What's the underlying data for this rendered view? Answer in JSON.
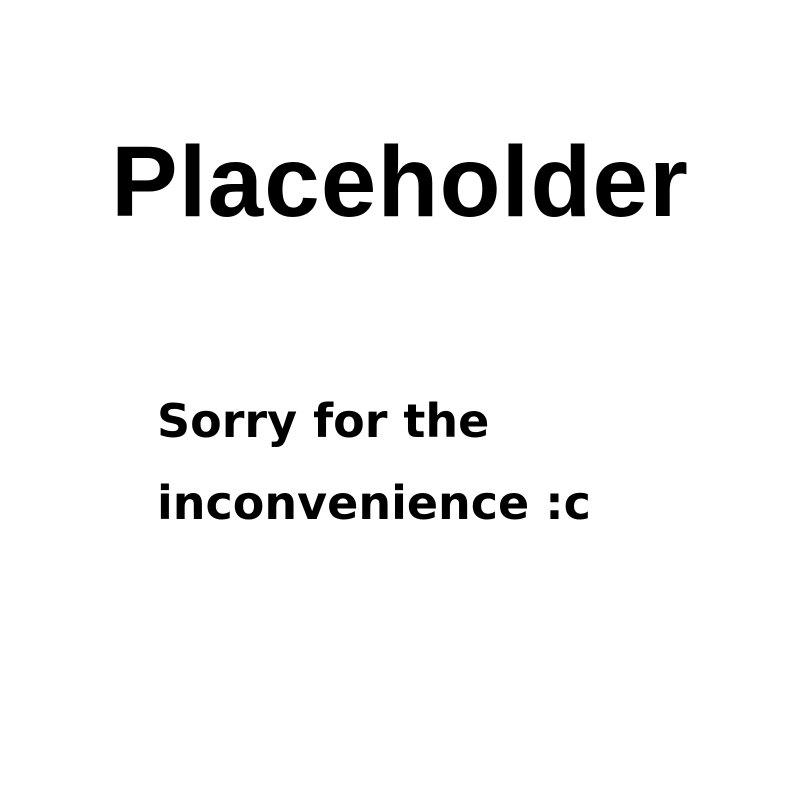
{
  "title": "Placeholder",
  "message": {
    "line1": "Sorry for the",
    "line2": "inconvenience :c"
  },
  "colors": {
    "background": "#ffffff",
    "text": "#000000"
  }
}
